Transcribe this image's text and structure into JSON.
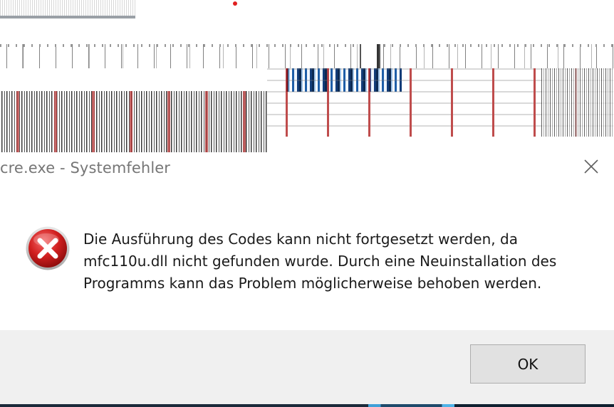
{
  "dialog": {
    "title": "cre.exe - Systemfehler",
    "message_lines": [
      "Die Ausführung des Codes kann nicht fortgesetzt werden, da",
      "mfc110u.dll nicht gefunden wurde. Durch eine Neuinstallation des",
      "Programms kann das Problem möglicherweise behoben werden."
    ],
    "ok_label": "OK",
    "icons": {
      "error": "error-icon",
      "close": "close-icon"
    }
  },
  "colors": {
    "footer_background": "#f0f0f0",
    "title_text": "#767676",
    "error_red": "#c8102e"
  }
}
